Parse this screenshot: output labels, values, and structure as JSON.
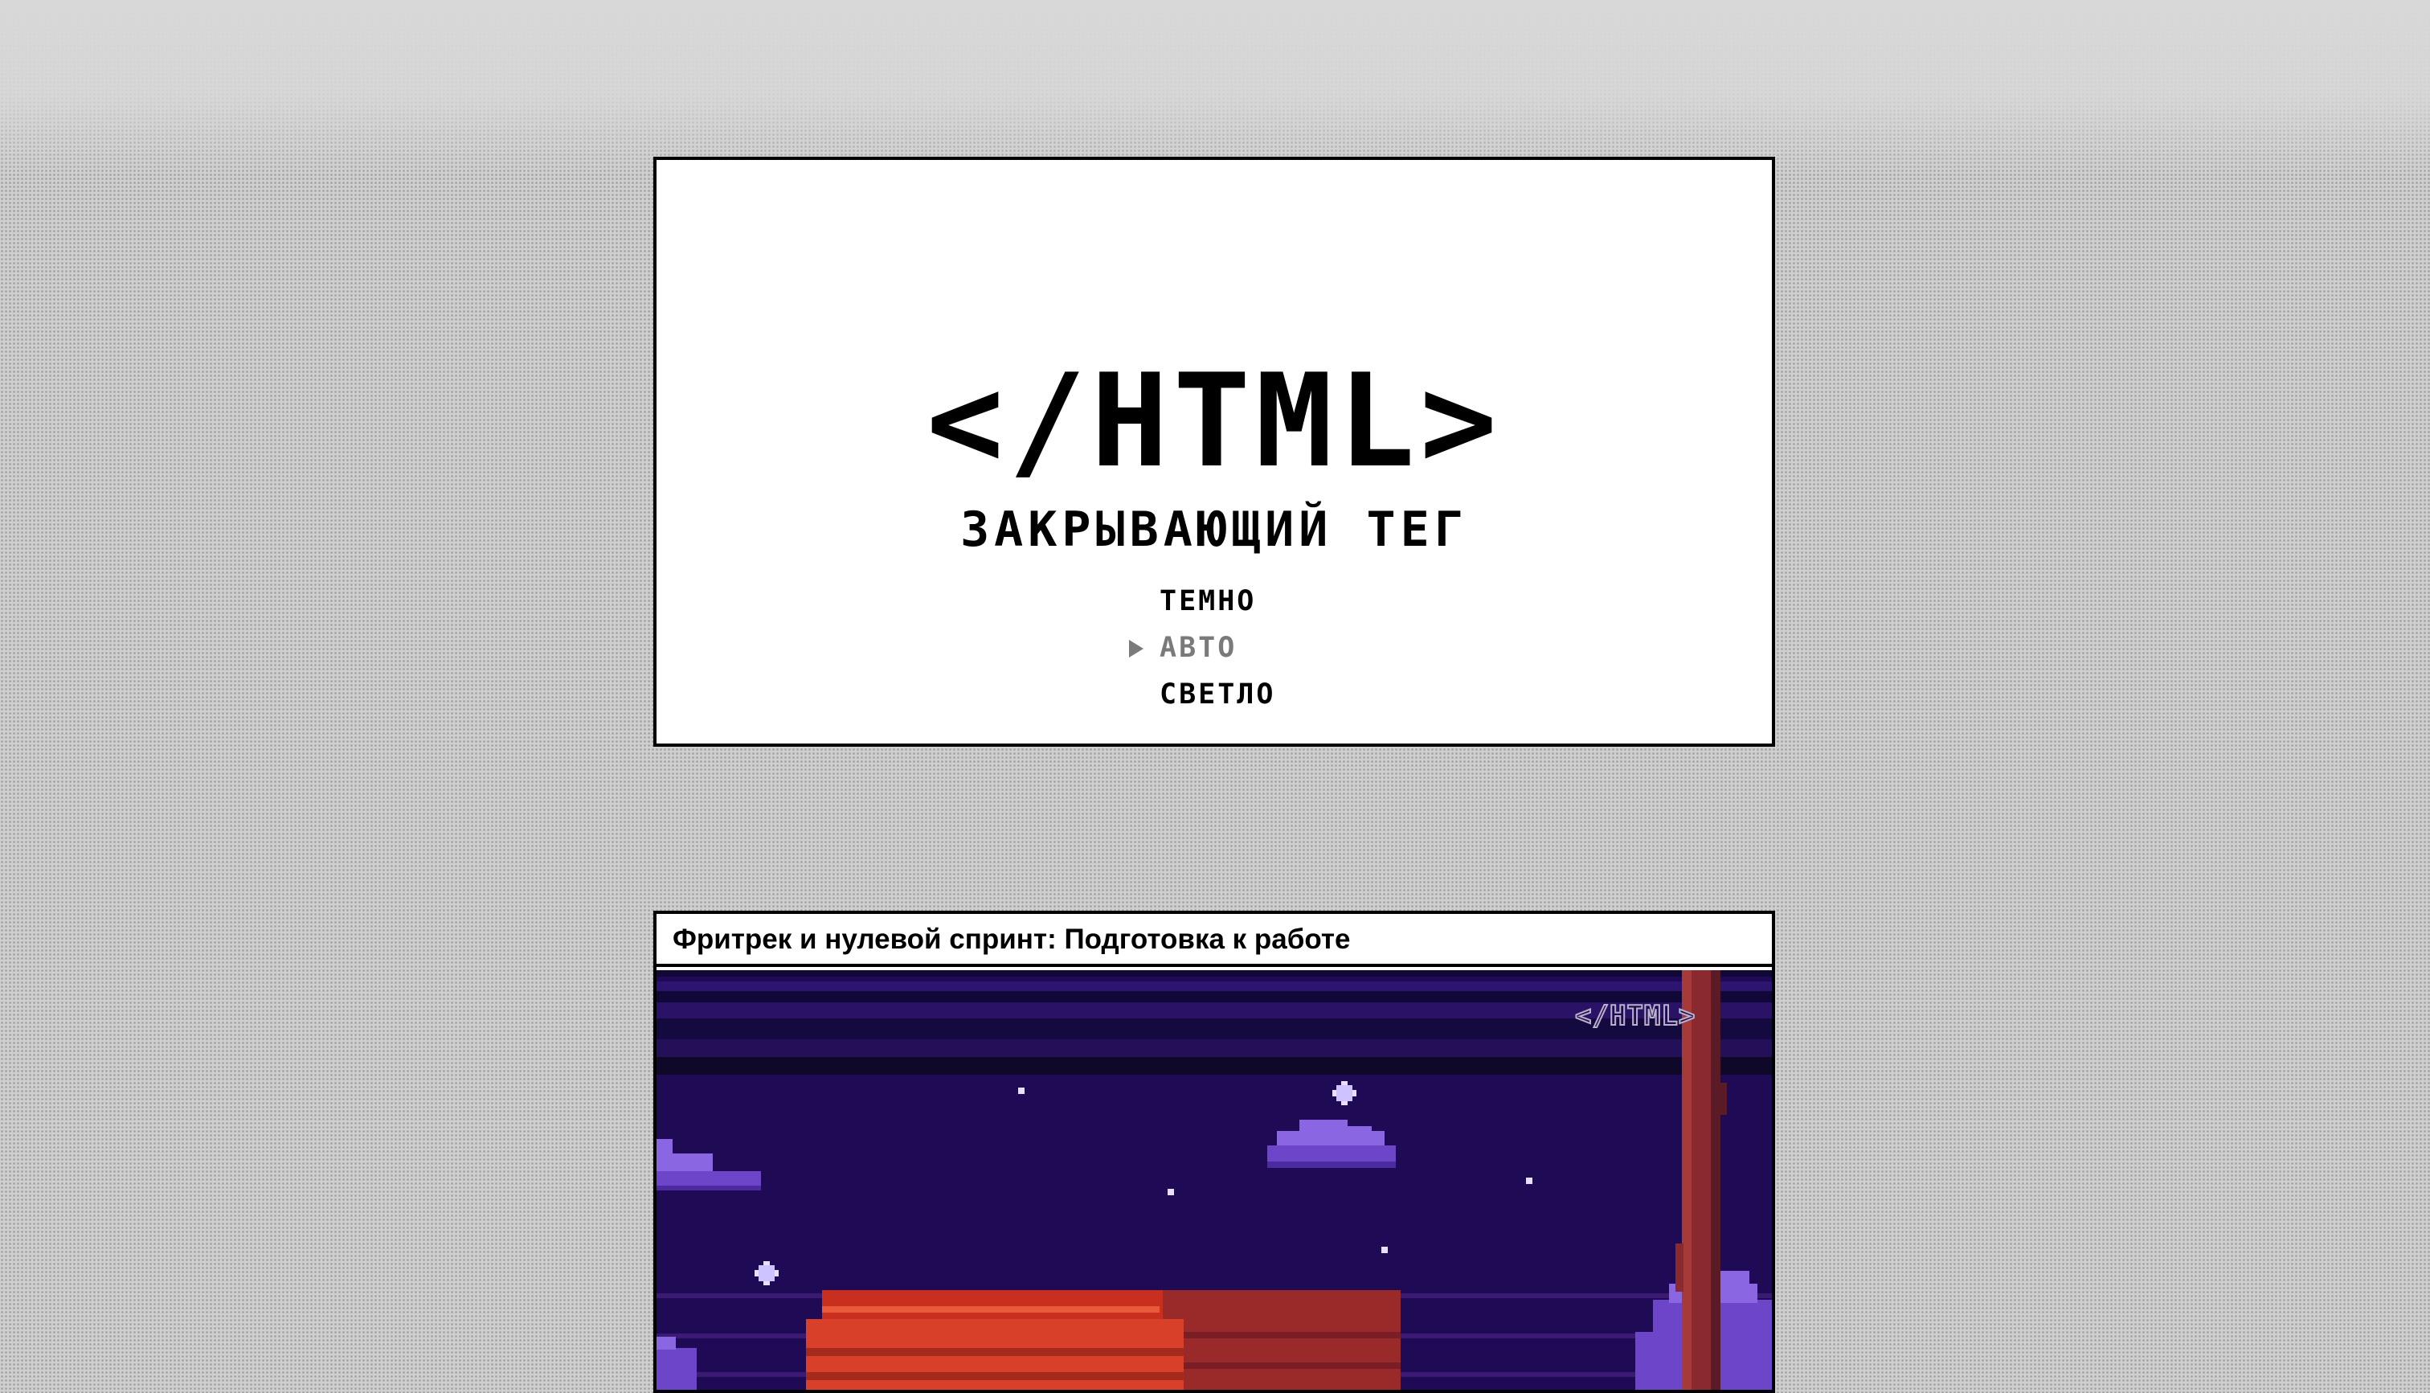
{
  "header": {
    "logo": "</HTML>",
    "tagline": "ЗАКРЫВАЮЩИЙ ТЕГ",
    "theme_options": [
      {
        "label": "ТЕМНО",
        "active": false
      },
      {
        "label": "АВТО",
        "active": true
      },
      {
        "label": "СВЕТЛО",
        "active": false
      }
    ]
  },
  "article": {
    "title": "Фритрек и нулевой спринт: Подготовка к работе",
    "image_logo": "</HTML>"
  },
  "colors": {
    "page_bg": "#cfcfcf",
    "card_bg": "#ffffff",
    "border": "#000000",
    "active_option": "#7a7a7a",
    "night_sky": "#1f0b55",
    "cloud": "#7c57d6",
    "couch": "#c92f1e",
    "tree_trunk": "#8a2a2e"
  },
  "icons": {
    "active_indicator": "triangle-right-icon",
    "stars": "sparkle-icon"
  }
}
